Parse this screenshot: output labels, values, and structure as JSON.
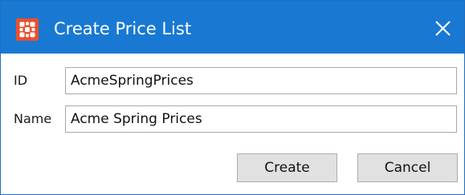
{
  "window": {
    "title": "Create Price List",
    "icon": "app-logo-icon",
    "close_icon": "close-icon",
    "accent_color": "#1979d2",
    "icon_color": "#e8502e"
  },
  "form": {
    "id_label": "ID",
    "id_value": "AcmeSpringPrices",
    "name_label": "Name",
    "name_value": "Acme Spring Prices"
  },
  "actions": {
    "create_label": "Create",
    "cancel_label": "Cancel"
  }
}
